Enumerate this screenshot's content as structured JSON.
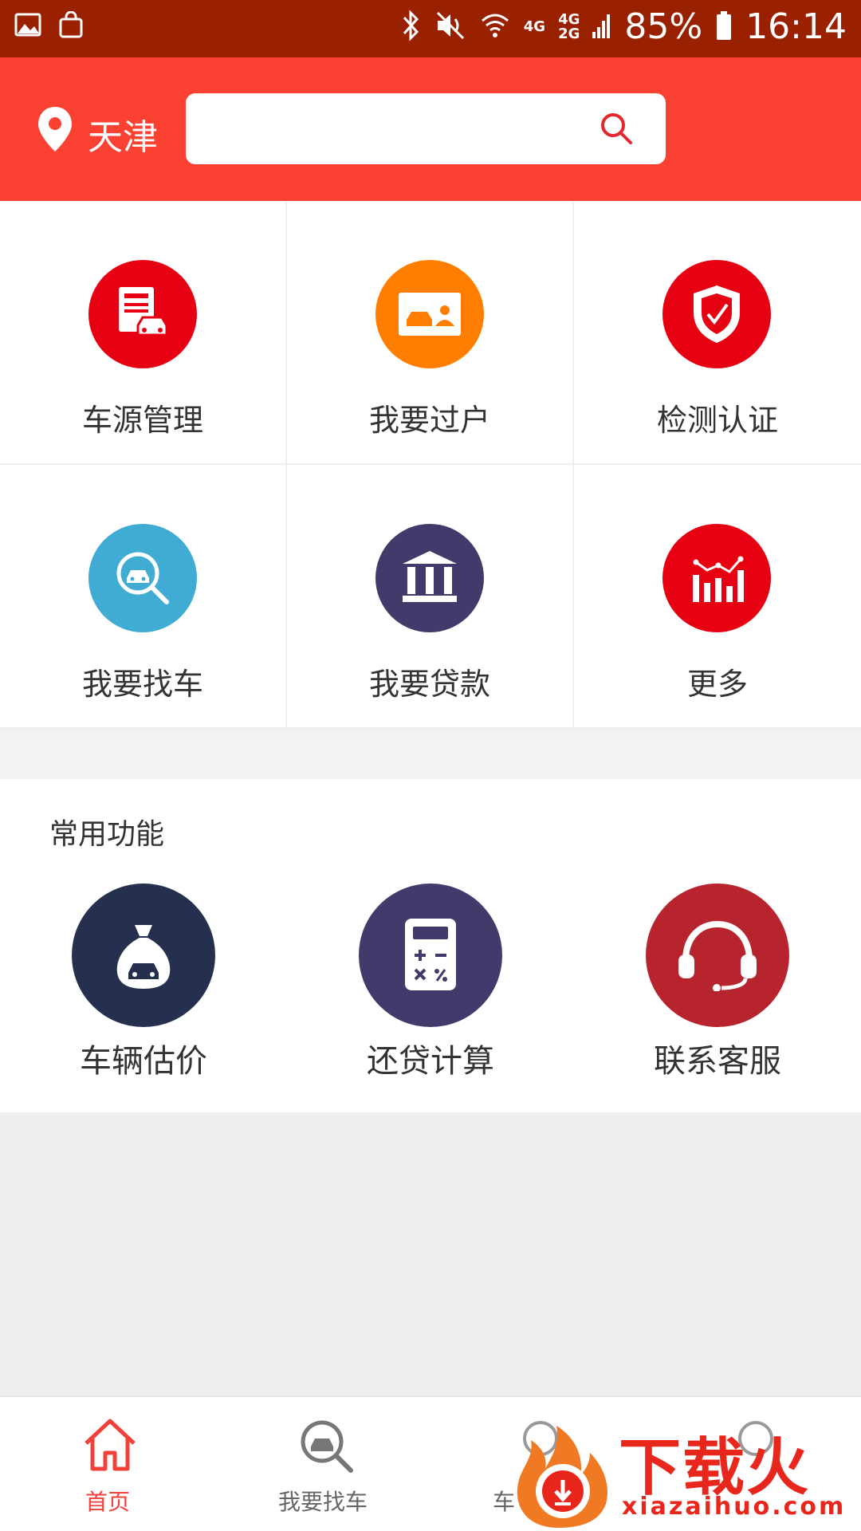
{
  "status_bar": {
    "network_top": "4G",
    "network_dual_top": "4G",
    "network_dual_bottom": "2G",
    "battery": "85%",
    "time": "16:14",
    "icons": [
      "gallery-icon",
      "shopping-bag-icon",
      "bluetooth-icon",
      "mute-icon",
      "wifi-icon",
      "signal-icon",
      "battery-icon"
    ]
  },
  "header": {
    "city": "天津",
    "search_placeholder": ""
  },
  "grid_items": [
    {
      "label": "车源管理",
      "icon": "car-source-icon",
      "color": "#e60012"
    },
    {
      "label": "我要过户",
      "icon": "transfer-icon",
      "color": "#ff7e00"
    },
    {
      "label": "检测认证",
      "icon": "shield-check-icon",
      "color": "#e60012"
    },
    {
      "label": "我要找车",
      "icon": "car-search-icon",
      "color": "#40acd4"
    },
    {
      "label": "我要贷款",
      "icon": "bank-icon",
      "color": "#433a6b"
    },
    {
      "label": "更多",
      "icon": "chart-icon",
      "color": "#e60012"
    }
  ],
  "common": {
    "title": "常用功能",
    "tools": [
      {
        "label": "车辆估价",
        "icon": "money-bag-icon",
        "color": "#24304e"
      },
      {
        "label": "还贷计算",
        "icon": "calculator-icon",
        "color": "#433a6b"
      },
      {
        "label": "联系客服",
        "icon": "headset-icon",
        "color": "#b7242d"
      }
    ]
  },
  "tabs": [
    {
      "label": "首页",
      "icon": "home-icon",
      "active": true
    },
    {
      "label": "我要找车",
      "icon": "car-search-icon",
      "active": false
    },
    {
      "label": "车",
      "icon": "tab3-icon",
      "active": false
    },
    {
      "label": "",
      "icon": "tab4-icon",
      "active": false
    }
  ],
  "watermark": {
    "brand": "下载火",
    "url": "xiazaihuo.com"
  }
}
